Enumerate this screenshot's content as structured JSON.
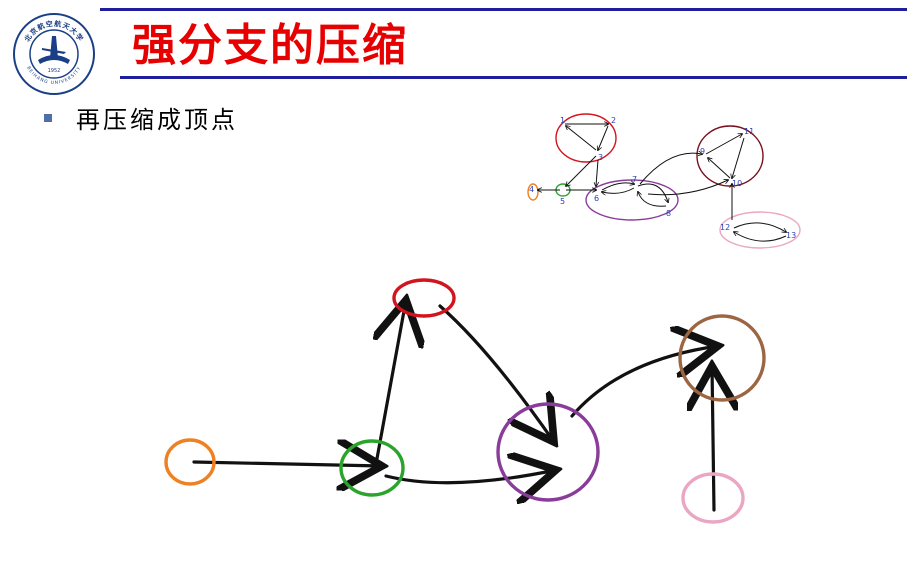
{
  "slide": {
    "title": "强分支的压缩",
    "bullet": "再压缩成顶点"
  },
  "logo": {
    "motto": "北京航空航天大学",
    "year": "1952",
    "english": "BEIHANG UNIVERSITY"
  },
  "thumbnail": {
    "labels": [
      "1",
      "2",
      "3",
      "4",
      "5",
      "6",
      "7",
      "8",
      "9",
      "10",
      "11",
      "12",
      "13"
    ]
  },
  "colors": {
    "rule": "#1f1f9e",
    "title": "#e60000",
    "bullet": "#4f6fa8",
    "logo": "#1b3f87",
    "node_red": "#d2141e",
    "node_orange": "#ee8122",
    "node_green": "#2aa42a",
    "node_purple": "#8a3c9b",
    "node_brown": "#9c6642",
    "node_pink": "#eaa6c2",
    "thumb_label": "#2b3fb5",
    "thumb_maroon": "#7a1020"
  }
}
